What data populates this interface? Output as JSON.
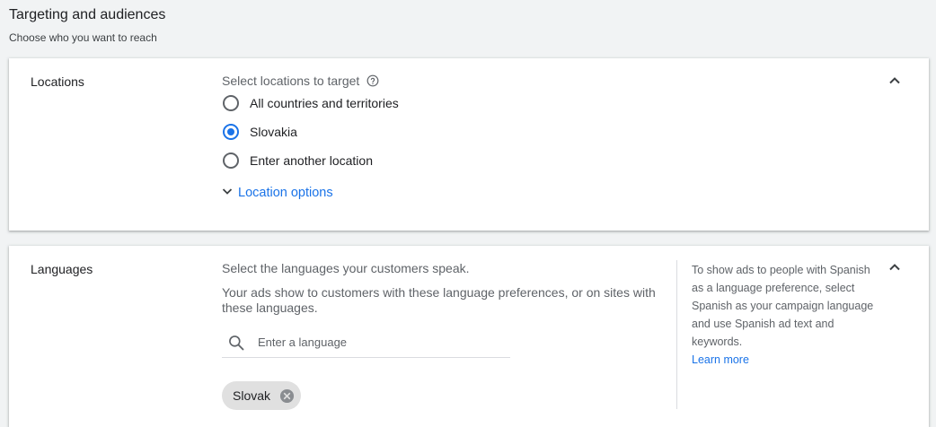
{
  "header": {
    "title": "Targeting and audiences",
    "subtitle": "Choose who you want to reach"
  },
  "locations": {
    "label": "Locations",
    "prompt": "Select locations to target",
    "options": [
      {
        "label": "All countries and territories",
        "checked": false
      },
      {
        "label": "Slovakia",
        "checked": true
      },
      {
        "label": "Enter another location",
        "checked": false
      }
    ],
    "more_options": "Location options",
    "collapse_icon": "chevron-up-icon",
    "help_icon": "help-circle-icon"
  },
  "languages": {
    "label": "Languages",
    "prompt": "Select the languages your customers speak.",
    "description": "Your ads show to customers with these language preferences, or on sites with these languages.",
    "search_placeholder": "Enter a language",
    "selected": [
      {
        "label": "Slovak"
      }
    ],
    "side_note": "To show ads to people with Spanish as a language preference, select Spanish as your campaign language and use Spanish ad text and keywords.",
    "learn_more": "Learn more",
    "collapse_icon": "chevron-up-icon"
  },
  "colors": {
    "accent": "#1a73e8",
    "page_background": "#f1f3f4",
    "chip_background": "#e0e0e0"
  }
}
